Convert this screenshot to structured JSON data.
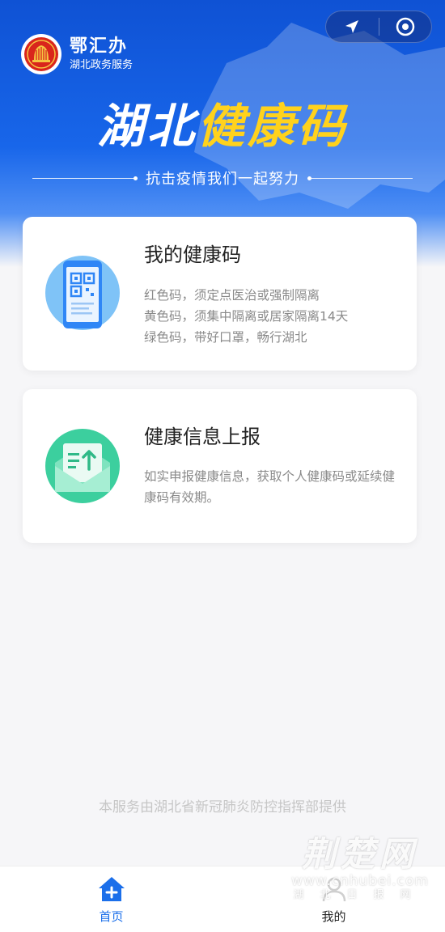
{
  "brand": {
    "name": "鄂汇办",
    "subtitle": "湖北政务服务"
  },
  "hero": {
    "title_white": "湖北",
    "title_yellow": "健康码",
    "slogan": "抗击疫情我们一起努力"
  },
  "cards": [
    {
      "title": "我的健康码",
      "lines": [
        "红色码，须定点医治或强制隔离",
        "黄色码，须集中隔离或居家隔离14天",
        "绿色码，带好口罩，畅行湖北"
      ],
      "icon": "qr-code-phone-icon"
    },
    {
      "title": "健康信息上报",
      "lines": [
        "如实申报健康信息，获取个人健康码或延续健康码有效期。"
      ],
      "icon": "upload-envelope-icon"
    }
  ],
  "footer_note": "本服务由湖北省新冠肺炎防控指挥部提供",
  "watermark": {
    "title": "荆楚网",
    "url": "www.cnhubei.com",
    "sub": "湖北日报网"
  },
  "tabs": [
    {
      "label": "首页",
      "icon": "home-icon",
      "active": true
    },
    {
      "label": "我的",
      "icon": "profile-icon",
      "active": false
    }
  ],
  "colors": {
    "primary_blue": "#1866ea",
    "title_yellow": "#ffd21d",
    "tab_active": "#1b6fea",
    "card_icon_blue": "#2f86f6",
    "card_icon_green": "#3ccf9e"
  }
}
